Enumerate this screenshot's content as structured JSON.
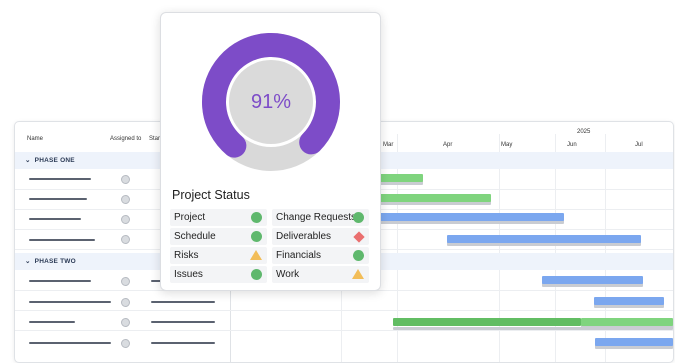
{
  "table": {
    "columns": [
      "Name",
      "Assigned to",
      "Start"
    ],
    "phases": [
      {
        "label": "PHASE ONE"
      },
      {
        "label": "PHASE TWO"
      }
    ]
  },
  "timeline": {
    "year": "2025",
    "months": [
      "Mar",
      "Apr",
      "May",
      "Jun",
      "Jul"
    ]
  },
  "status_card": {
    "percent_label": "91%",
    "percent_value": 91,
    "title": "Project Status",
    "colors": {
      "progress": "#7d4cc8",
      "track": "#d9d9d9",
      "good": "#5fb86d",
      "warn": "#f2bd58",
      "bad": "#ea6f6f"
    },
    "items": [
      {
        "label": "Project",
        "status": "green-circle"
      },
      {
        "label": "Change Requests",
        "status": "green-circle"
      },
      {
        "label": "Schedule",
        "status": "green-circle"
      },
      {
        "label": "Deliverables",
        "status": "red-diamond"
      },
      {
        "label": "Risks",
        "status": "yellow-triangle"
      },
      {
        "label": "Financials",
        "status": "green-circle"
      },
      {
        "label": "Issues",
        "status": "green-circle"
      },
      {
        "label": "Work",
        "status": "yellow-triangle"
      }
    ]
  }
}
